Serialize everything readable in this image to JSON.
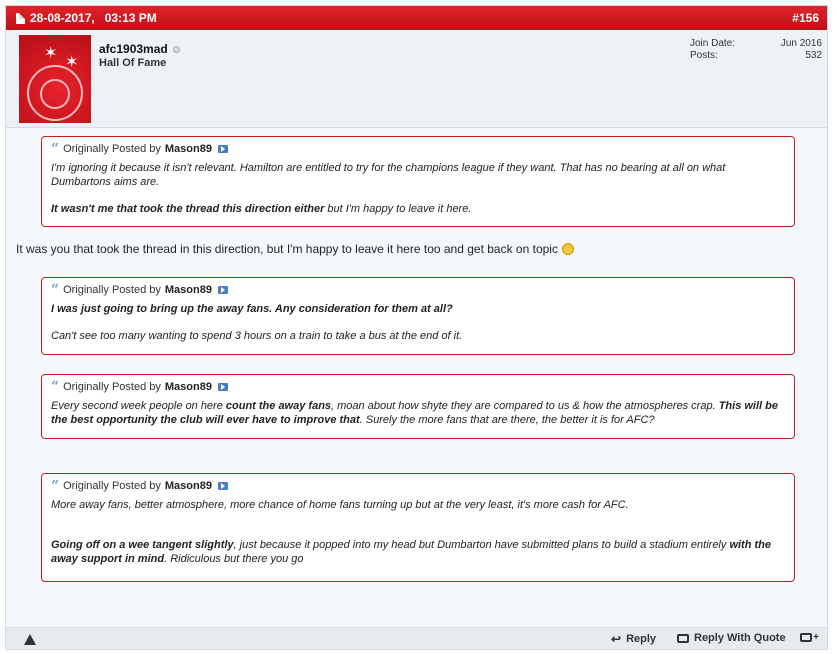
{
  "post": {
    "date": "28-08-2017,",
    "time": "03:13 PM",
    "number": "#156"
  },
  "user": {
    "name": "afc1903mad",
    "title": "Hall Of Fame",
    "join_label": "Join Date:",
    "join_value": "Jun 2016",
    "posts_label": "Posts:",
    "posts_value": "532"
  },
  "quote_prefix": "Originally Posted by",
  "quotes": [
    {
      "author": "Mason89",
      "p1": "I'm ignoring it because it isn't relevant. Hamilton are entitled to try for the champions league if they want. That has no bearing at all on what Dumbartons aims are.",
      "p2_bold": "It wasn't me that took the thread this direction either",
      "p2_rest": " but I'm happy to leave it here."
    },
    {
      "author": "Mason89",
      "p1_bold": "I was just going to bring up the away fans. Any consideration for them at all?",
      "p2": "Can't see too many wanting to spend 3 hours on a train to take a bus at the end of it."
    },
    {
      "author": "Mason89",
      "t1": "Every second week people on here ",
      "t2_bold": "count the away fans",
      "t3": ", moan about how shyte they are compared to us & how the atmospheres crap. ",
      "t4_bold": "This will be the best opportunity the club will ever have to improve that",
      "t5": ". Surely the more fans that are there, the better it is for AFC?"
    },
    {
      "author": "Mason89",
      "p1": "More away fans, better atmosphere, more chance of home fans turning up but at the very least, it's more cash for AFC.",
      "p2_bold": "Going off on a wee tangent slightly",
      "p2_mid": ", just because it popped into my head but Dumbarton have submitted plans to build a stadium entirely ",
      "p2_bold2": "with the away support in mind",
      "p2_end": ". Ridiculous but there you go"
    }
  ],
  "reply_text": "It was you that took the thread in this direction, but I'm happy to leave it here too and get back on topic",
  "footer": {
    "reply": "Reply",
    "reply_with_quote": "Reply With Quote"
  },
  "colors": {
    "header_red": "#d41a22",
    "quote_border": "#c62027",
    "post_bg": "#f5f8fa"
  },
  "icons": [
    "document-icon",
    "offline-status-icon",
    "quote-icon",
    "view-post-icon",
    "smiley-icon",
    "warning-icon",
    "reply-icon",
    "reply-with-quote-icon",
    "multi-quote-icon"
  ]
}
